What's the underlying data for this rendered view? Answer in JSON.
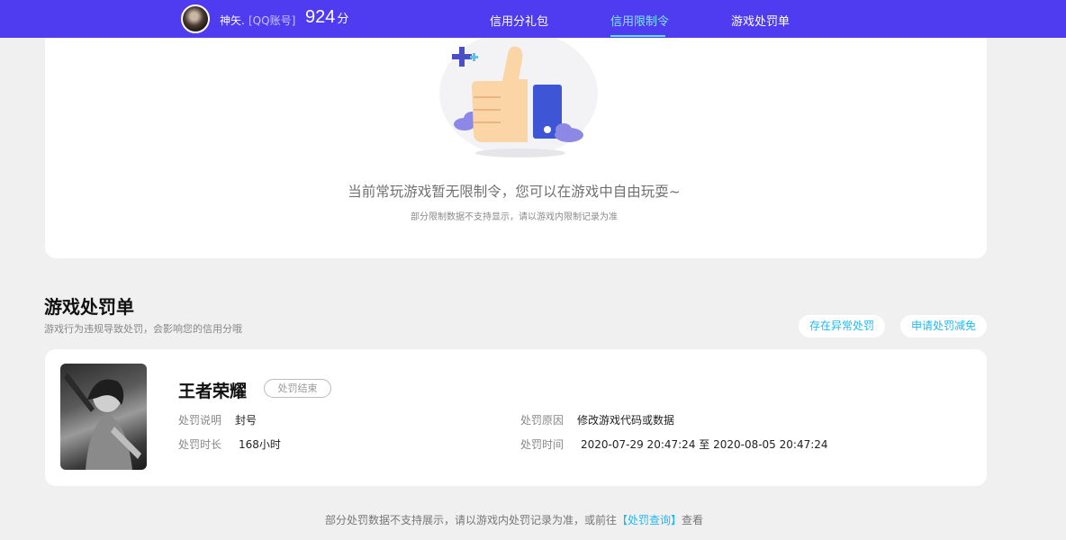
{
  "header": {
    "user_name": "神矢.",
    "account_type": "[QQ账号]",
    "score": "924",
    "score_unit": "分",
    "tabs": [
      {
        "label": "信用分礼包"
      },
      {
        "label": "信用限制令"
      },
      {
        "label": "游戏处罚单"
      }
    ],
    "active_tab": "信用限制令",
    "accent_color": "#4f3bf0"
  },
  "restriction": {
    "empty_title": "当前常玩游戏暂无限制令，您可以在游戏中自由玩耍~",
    "empty_note": "部分限制数据不支持显示，请以游戏内限制记录为准",
    "illustration_icon": "thumbs-up-icon"
  },
  "penalty": {
    "title": "游戏处罚单",
    "subtitle": "游戏行为违规导致处罚，会影响您的信用分哦",
    "actions": [
      {
        "label": "存在异常处罚"
      },
      {
        "label": "申请处罚减免"
      }
    ],
    "records": [
      {
        "game": "王者荣耀",
        "status": "处罚结束",
        "desc_label": "处罚说明",
        "desc_value": "封号",
        "duration_label": "处罚时长",
        "duration_value": "168小时",
        "reason_label": "处罚原因",
        "reason_value": "修改游戏代码或数据",
        "time_label": "处罚时间",
        "time_value": "2020-07-29 20:47:24 至 2020-08-05 20:47:24"
      }
    ]
  },
  "footer": {
    "prefix": "部分处罚数据不支持展示，请以游戏内处罚记录为准，或前往",
    "link": "【处罚查询】",
    "suffix": "查看"
  }
}
